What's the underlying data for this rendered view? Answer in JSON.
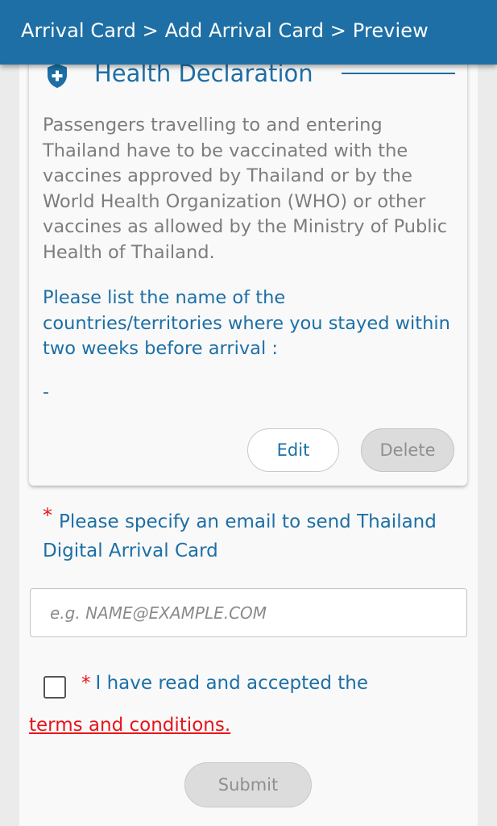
{
  "header": {
    "breadcrumb": "Arrival Card > Add Arrival Card > Preview"
  },
  "health_declaration": {
    "icon": "shield-plus-icon",
    "title": "Health Declaration",
    "description": "Passengers travelling to and entering Thailand have to be vaccinated with the vaccines approved by Thailand or by the World Health Organization (WHO) or other vaccines as allowed by the Ministry of Public Health of Thailand.",
    "countries_question": "Please list the name of the countries/territories where you stayed within two weeks before arrival :",
    "countries_value": "-",
    "edit_label": "Edit",
    "delete_label": "Delete"
  },
  "email": {
    "required_mark": "*",
    "label": "Please specify an email to send Thailand Digital Arrival Card",
    "placeholder": "e.g. NAME@EXAMPLE.COM",
    "value": ""
  },
  "terms": {
    "checked": false,
    "required_mark": "*",
    "accept_text": "I have read and accepted the",
    "link_text": "terms and conditions."
  },
  "submit_label": "Submit",
  "colors": {
    "brand_blue": "#1d6fa5",
    "required_red": "#e8141b",
    "disabled_grey": "#dcdcdc"
  }
}
